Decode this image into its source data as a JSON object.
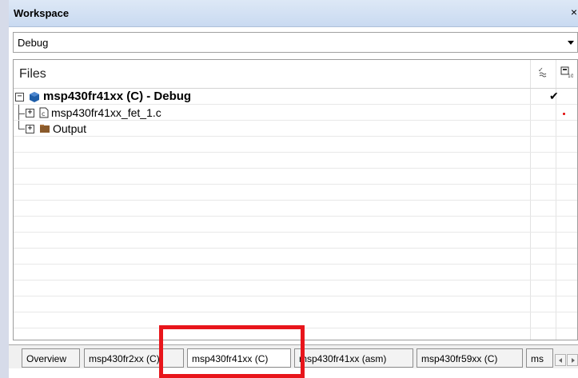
{
  "workspace": {
    "title": "Workspace",
    "close_glyph": "×"
  },
  "config": {
    "selected": "Debug"
  },
  "files": {
    "header": "Files",
    "header_icons": [
      "build-status-icon",
      "options-icon"
    ],
    "items": [
      {
        "label": "msp430fr41xx (C) - Debug",
        "icon": "project-hexagon-icon",
        "expander": "⊟",
        "status": "✔"
      },
      {
        "label": "msp430fr41xx_fet_1.c",
        "icon": "c-file-icon",
        "expander": "⊞",
        "status": ""
      },
      {
        "label": "Output",
        "icon": "folder-icon",
        "expander": "⊞",
        "status": ""
      }
    ]
  },
  "tabs": [
    {
      "label": "Overview"
    },
    {
      "label": "msp430fr2xx (C)"
    },
    {
      "label": "msp430fr41xx (C)",
      "active": true
    },
    {
      "label": "msp430fr41xx (asm)"
    },
    {
      "label": "msp430fr59xx (C)"
    },
    {
      "label": "ms"
    }
  ],
  "colors": {
    "highlight": "#e8151b",
    "title_bg": "#c9daf1",
    "project_icon": "#1f5ea8"
  }
}
